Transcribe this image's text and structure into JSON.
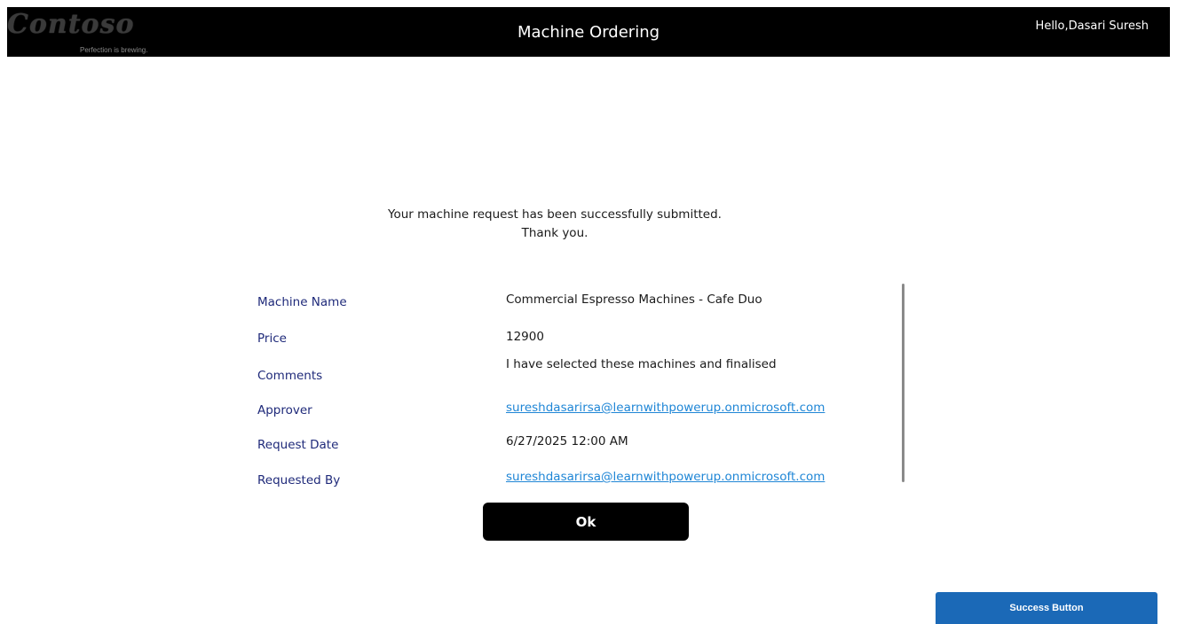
{
  "header": {
    "logo_text": "Contoso",
    "logo_tagline": "Perfection is brewing.",
    "title": "Machine Ordering",
    "greeting": "Hello,Dasari Suresh"
  },
  "message": {
    "line1": "Your machine request has been successfully submitted.",
    "line2": "Thank you."
  },
  "details": {
    "machine_name_label": "Machine Name",
    "machine_name_value": "Commercial Espresso Machines - Cafe Duo",
    "price_label": "Price",
    "price_value": "12900",
    "comments_label": "Comments",
    "comments_value": "I have selected these machines and finalised",
    "approver_label": "Approver",
    "approver_value": "sureshdasarirsa@learnwithpowerup.onmicrosoft.com",
    "request_date_label": "Request Date",
    "request_date_value": "6/27/2025 12:00 AM",
    "requested_by_label": "Requested By",
    "requested_by_value": "sureshdasarirsa@learnwithpowerup.onmicrosoft.com"
  },
  "actions": {
    "ok_label": "Ok",
    "success_label": "Success Button"
  },
  "colors": {
    "header_bg": "#000000",
    "label_color": "#1f2a7a",
    "link_color": "#1f86d6",
    "success_button_bg": "#1b69b7"
  }
}
